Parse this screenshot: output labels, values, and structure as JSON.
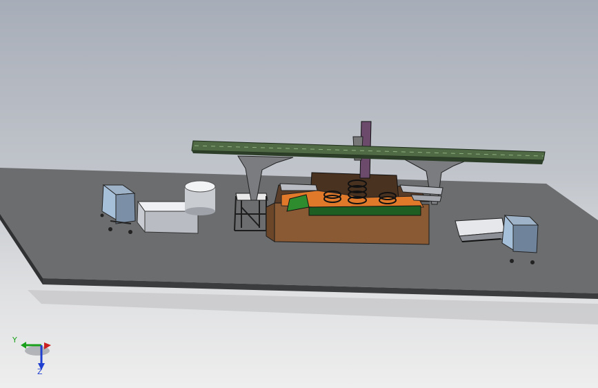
{
  "viewport": {
    "background_top": "#a7adb8",
    "background_bottom": "#eeeeee"
  },
  "model": {
    "components": [
      "ground-plate",
      "overhead-gantry-beam",
      "vertical-column",
      "press-base",
      "orange-fixture",
      "green-side-plate",
      "spring-coils",
      "storage-cart-left",
      "storage-cart-right",
      "open-bin",
      "round-bucket",
      "frame-stand",
      "conveyor-tray"
    ],
    "colors": {
      "plate_top": "#6b6d6f",
      "plate_edge": "#3d3f41",
      "beam": "#4f6a45",
      "column": "#6b4a6b",
      "base": "#5c3e28",
      "base_front": "#5e3f2a",
      "fixture": "#e07a2a",
      "green_plate": "#2e8b2e"
    }
  },
  "triad": {
    "x_label": "",
    "y_label": "Y",
    "z_label": "Z",
    "y_color": "#1aa01a",
    "z_color": "#1f3fd0",
    "x_color": "#cc2020"
  }
}
